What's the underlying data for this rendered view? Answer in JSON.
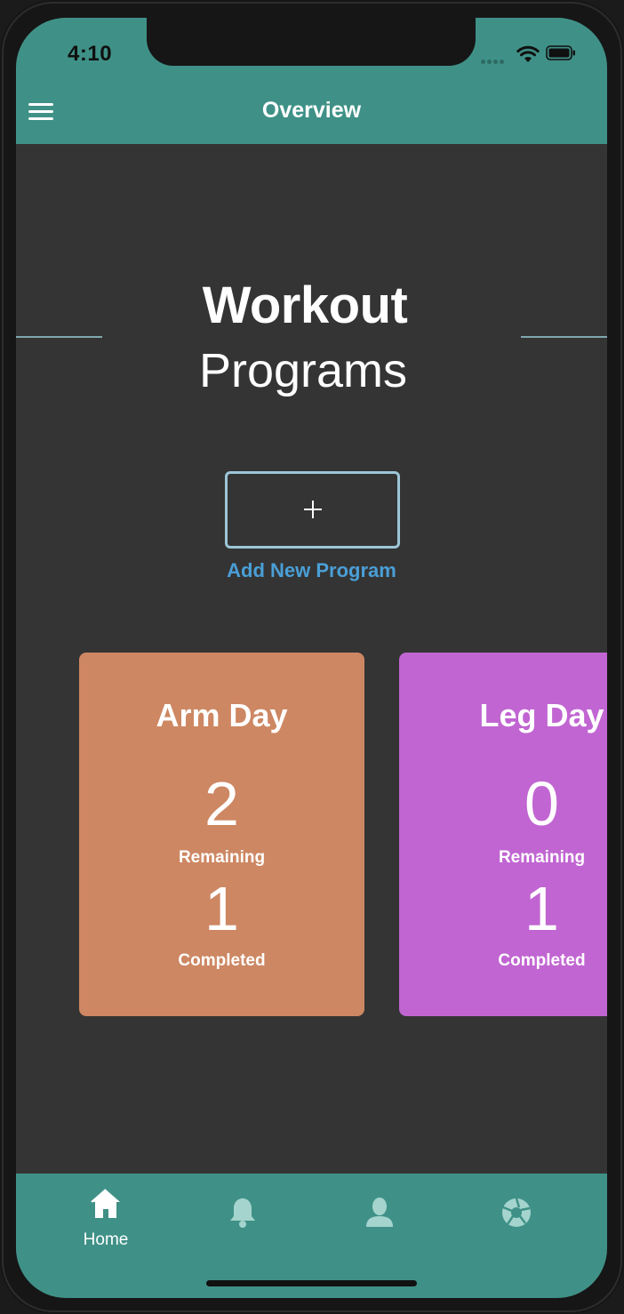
{
  "status_bar": {
    "time": "4:10"
  },
  "header": {
    "title": "Overview",
    "menu_icon": "hamburger-menu-icon"
  },
  "hero": {
    "title_bold": "Workout",
    "title_light": "Programs"
  },
  "add_program": {
    "icon": "plus-icon",
    "label": "Add New Program"
  },
  "programs": [
    {
      "name": "Arm Day",
      "remaining": "2",
      "remaining_label": "Remaining",
      "completed": "1",
      "completed_label": "Completed",
      "color": "#cd8762"
    },
    {
      "name": "Leg Day",
      "remaining": "0",
      "remaining_label": "Remaining",
      "completed": "1",
      "completed_label": "Completed",
      "color": "#c165d2"
    }
  ],
  "tabbar": {
    "tabs": [
      {
        "icon": "home-icon",
        "label": "Home",
        "active": true
      },
      {
        "icon": "bell-icon",
        "label": "",
        "active": false
      },
      {
        "icon": "user-icon",
        "label": "",
        "active": false
      },
      {
        "icon": "aperture-icon",
        "label": "",
        "active": false
      }
    ]
  },
  "colors": {
    "accent": "#3f9187",
    "background": "#343434",
    "link": "#4a9fd6"
  }
}
